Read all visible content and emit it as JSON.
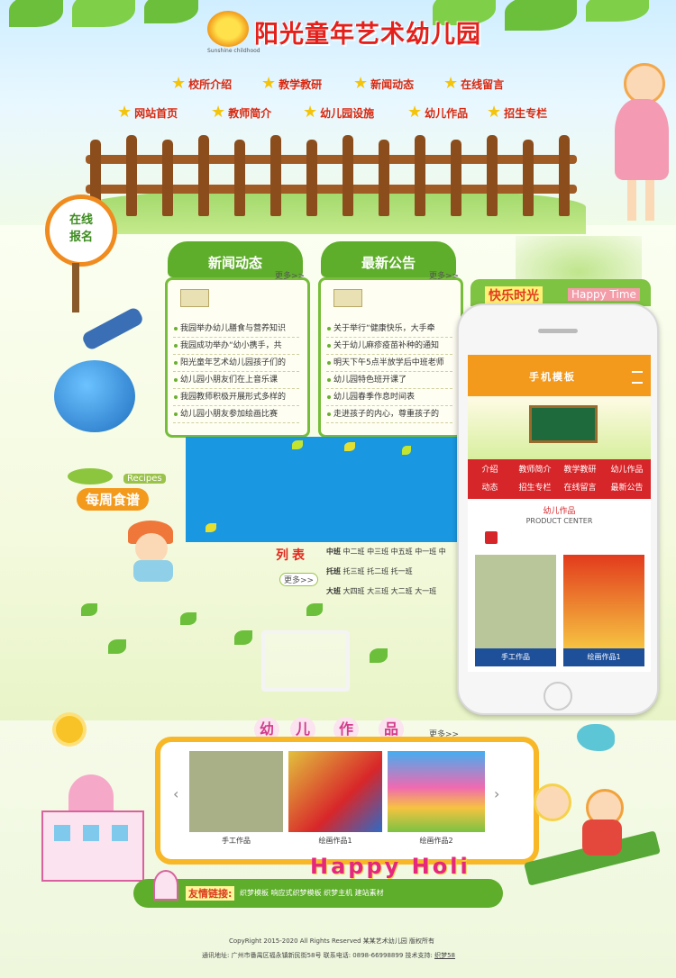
{
  "header": {
    "title": "阳光童年艺术幼儿园",
    "logo_text": "Sunshine childhood"
  },
  "nav": {
    "row1": [
      "校所介绍",
      "教学教研",
      "新闻动态",
      "在线留言"
    ],
    "row2": [
      "网站首页",
      "教师简介",
      "幼儿园设施",
      "幼儿作品",
      "招生专栏"
    ]
  },
  "signup_badge": [
    "在线",
    "报名"
  ],
  "recipes": {
    "en": "Recipes",
    "cn": "每周食谱"
  },
  "news": {
    "title": "新闻动态",
    "more": "更多>>",
    "items": [
      "我园举办幼儿膳食与营养知识",
      "我园成功举办“幼小携手，共",
      "阳光童年艺术幼儿园孩子们的",
      "幼儿园小朋友们在上音乐课",
      "我园教师积极开展形式多样的",
      "幼儿园小朋友参加绘画比赛"
    ]
  },
  "notice": {
    "title": "最新公告",
    "more": "更多>>",
    "items": [
      "关于举行“健康快乐，大手牵",
      "关于幼儿麻疹疫苗补种的通知",
      "明天下午5点半放学后中班老师",
      "幼儿园特色班开课了",
      "幼儿园春季作息时间表",
      "走进孩子的内心，尊重孩子的"
    ]
  },
  "happy": {
    "cn": "快乐时光",
    "en": "Happy Time"
  },
  "classes": {
    "title": "列表",
    "more": "更多>>",
    "rows": [
      {
        "label": "中班",
        "items": [
          "中二班",
          "中三班",
          "中五班",
          "中一班",
          "中"
        ]
      },
      {
        "label": "托班",
        "items": [
          "托三班",
          "托二班",
          "托一班"
        ]
      },
      {
        "label": "大班",
        "items": [
          "大四班",
          "大三班",
          "大二班",
          "大一班"
        ]
      }
    ]
  },
  "mobile": {
    "title": "手机模板",
    "nav_row1": [
      "介绍",
      "教师简介",
      "教学教研",
      "幼儿作品"
    ],
    "nav_row2": [
      "动态",
      "招生专栏",
      "在线留言",
      "最新公告"
    ],
    "section_title": "幼儿作品",
    "section_sub": "PRODUCT CENTER",
    "products": [
      "手工作品",
      "绘画作品1"
    ]
  },
  "works": {
    "title": [
      "幼",
      "儿",
      "作",
      "品"
    ],
    "more": "更多>>",
    "items": [
      "手工作品",
      "绘画作品1",
      "绘画作品2"
    ]
  },
  "happy_holi": "Happy Holi",
  "friend_links": {
    "label": "友情链接:",
    "links": [
      "织梦模板",
      "响应式织梦模板",
      "织梦主机",
      "建站素材"
    ]
  },
  "footer": {
    "copyright": "CopyRight 2015-2020 All Rights Reserved  某某艺术幼儿园 版权所有",
    "address": "通讯地址: 广州市番禺区福永镇新民街58号  联系电话: 0898-66998899  技术支持:",
    "support_link": "织梦58"
  },
  "colors": {
    "brand_red": "#d9280f",
    "green": "#5fae2b",
    "mobile_orange": "#f39a1c",
    "mobile_red": "#d7262a"
  }
}
